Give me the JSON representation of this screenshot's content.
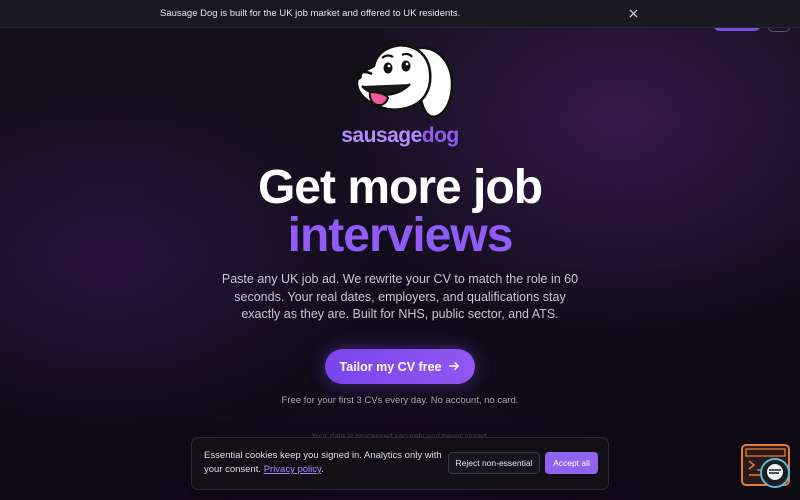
{
  "banner": {
    "text": "Sausage Dog is built for the UK job market and offered to UK residents.",
    "close_icon": "close-icon"
  },
  "brand": {
    "part1": "sausage",
    "part2": "dog",
    "logo_icon": "dog-mascot-logo"
  },
  "hero": {
    "line1": "Get more job",
    "line2": "interviews",
    "subtitle": "Paste any UK job ad. We rewrite your CV to match the role in 60 seconds. Your real dates, employers, and qualifications stay exactly as they are. Built for NHS, public sector, and ATS.",
    "cta_label": "Tailor my CV free",
    "cta_icon": "arrow-right-icon",
    "free_note": "Free for your first 3 CVs every day. No account, no card.",
    "faded_note": "Your data is processed securely and never stored."
  },
  "cookie": {
    "text": "Essential cookies keep you signed in. Analytics only with your consent.",
    "link": "Privacy policy",
    "after_link": ".",
    "reject_label": "Reject non-essential",
    "accept_label": "Accept all"
  },
  "colors": {
    "accent": "#8f5cf6",
    "background": "#0c0a12",
    "widget_border": "#e27a3b"
  },
  "widget": {
    "icon": "terminal-widget-icon",
    "chat_icon": "chat-bubble-icon"
  }
}
